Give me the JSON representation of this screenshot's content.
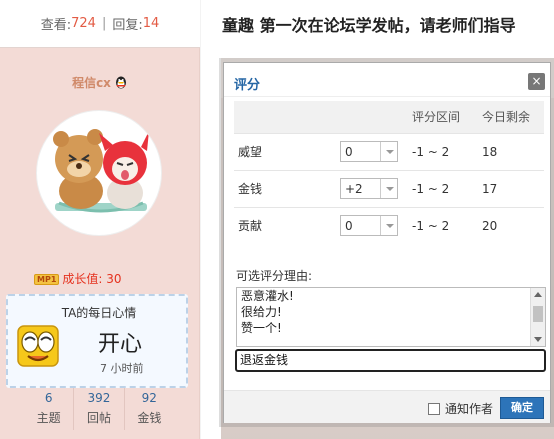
{
  "header": {
    "views_label": "查看:",
    "views": "724",
    "replies_label": "回复:",
    "replies": "14",
    "separator": "|"
  },
  "post": {
    "title": "童趣 第一次在论坛学发帖，请老师们指导"
  },
  "user": {
    "name": "程信cx",
    "growth_badge": "MP1",
    "growth": "成长值: 30",
    "mood_title": "TA的每日心情",
    "mood": "开心",
    "mood_time": "7 小时前",
    "stats": [
      {
        "value": "6",
        "label": "主题"
      },
      {
        "value": "392",
        "label": "回帖"
      },
      {
        "value": "92",
        "label": "金钱"
      }
    ]
  },
  "dialog": {
    "title": "评分",
    "close": "×",
    "columns": [
      "",
      "",
      "评分区间",
      "今日剩余"
    ],
    "rows": [
      {
        "name": "威望",
        "value": "0",
        "range": "-1 ~ 2",
        "remain": "18"
      },
      {
        "name": "金钱",
        "value": "+2",
        "range": "-1 ~ 2",
        "remain": "17"
      },
      {
        "name": "贡献",
        "value": "0",
        "range": "-1 ~ 2",
        "remain": "20"
      }
    ],
    "reason_label": "可选评分理由:",
    "reasons": [
      "恶意灌水!",
      "很给力!",
      "赞一个!"
    ],
    "reason_value": "退返金钱",
    "notify_label": "通知作者",
    "confirm_label": "确定"
  },
  "colors": {
    "accent": "#2d74b9",
    "count": "#e35b44",
    "sidebar_bg": "#f3dbd6"
  }
}
